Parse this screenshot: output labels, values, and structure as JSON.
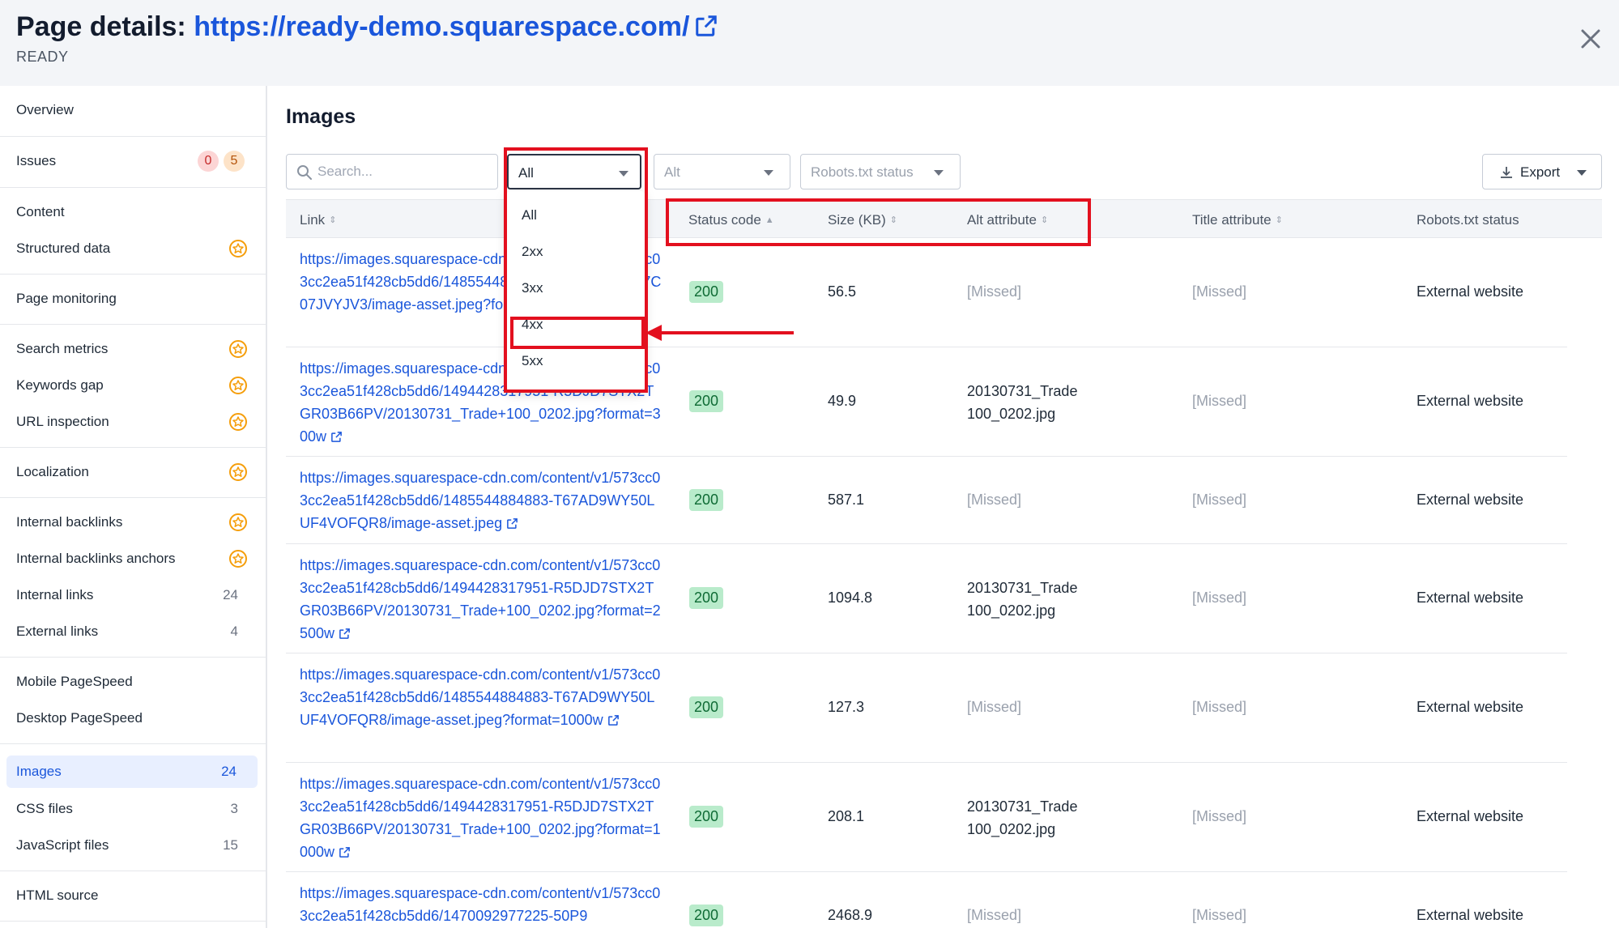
{
  "header": {
    "title_prefix": "Page details: ",
    "url": "https://ready-demo.squarespace.com/",
    "status": "READY"
  },
  "sidebar": {
    "items": [
      {
        "label": "Overview"
      },
      {
        "label": "Issues",
        "badge_errors": "0",
        "badge_warnings": "5"
      },
      {
        "label": "Content"
      },
      {
        "label": "Structured data"
      },
      {
        "label": "Page monitoring"
      },
      {
        "label": "Search metrics"
      },
      {
        "label": "Keywords gap"
      },
      {
        "label": "URL inspection"
      },
      {
        "label": "Localization"
      },
      {
        "label": "Internal backlinks"
      },
      {
        "label": "Internal backlinks anchors"
      },
      {
        "label": "Internal links",
        "count": "24"
      },
      {
        "label": "External links",
        "count": "4"
      },
      {
        "label": "Mobile PageSpeed"
      },
      {
        "label": "Desktop PageSpeed"
      },
      {
        "label": "Images",
        "count": "24"
      },
      {
        "label": "CSS files",
        "count": "3"
      },
      {
        "label": "JavaScript files",
        "count": "15"
      },
      {
        "label": "HTML source"
      }
    ]
  },
  "main": {
    "title": "Images",
    "search_placeholder": "Search...",
    "filters": {
      "status_value": "All",
      "alt_value": "Alt",
      "robots_value": "Robots.txt status"
    },
    "export_label": "Export",
    "status_options": [
      "All",
      "2xx",
      "3xx",
      "4xx",
      "5xx"
    ],
    "columns": [
      "Link",
      "Status code",
      "Size (KB)",
      "Alt attribute",
      "Title attribute",
      "Robots.txt status"
    ],
    "rows": [
      {
        "link": "https://images.squarespace-cdn.com/content/v1/573cc03cc2ea51f428cb5dd6/1485544884883-50P98KC41C7C07JVYJV3/image-asset.jpeg?format=300w",
        "status": "200",
        "size": "56.5",
        "alt": "[Missed]",
        "title": "[Missed]",
        "robots": "External website"
      },
      {
        "link": "https://images.squarespace-cdn.com/content/v1/573cc03cc2ea51f428cb5dd6/1494428317951-R5DJD7STX2TGR03B66PV/20130731_Trade+100_0202.jpg?format=300w",
        "status": "200",
        "size": "49.9",
        "alt": "20130731_Trade 100_0202.jpg",
        "title": "[Missed]",
        "robots": "External website"
      },
      {
        "link": "https://images.squarespace-cdn.com/content/v1/573cc03cc2ea51f428cb5dd6/1485544884883-T67AD9WY50LUF4VOFQR8/image-asset.jpeg",
        "status": "200",
        "size": "587.1",
        "alt": "[Missed]",
        "title": "[Missed]",
        "robots": "External website"
      },
      {
        "link": "https://images.squarespace-cdn.com/content/v1/573cc03cc2ea51f428cb5dd6/1494428317951-R5DJD7STX2TGR03B66PV/20130731_Trade+100_0202.jpg?format=2500w",
        "status": "200",
        "size": "1094.8",
        "alt": "20130731_Trade 100_0202.jpg",
        "title": "[Missed]",
        "robots": "External website"
      },
      {
        "link": "https://images.squarespace-cdn.com/content/v1/573cc03cc2ea51f428cb5dd6/1485544884883-T67AD9WY50LUF4VOFQR8/image-asset.jpeg?format=1000w",
        "status": "200",
        "size": "127.3",
        "alt": "[Missed]",
        "title": "[Missed]",
        "robots": "External website"
      },
      {
        "link": "https://images.squarespace-cdn.com/content/v1/573cc03cc2ea51f428cb5dd6/1494428317951-R5DJD7STX2TGR03B66PV/20130731_Trade+100_0202.jpg?format=1000w",
        "status": "200",
        "size": "208.1",
        "alt": "20130731_Trade 100_0202.jpg",
        "title": "[Missed]",
        "robots": "External website"
      },
      {
        "link": "https://images.squarespace-cdn.com/content/v1/573cc03cc2ea51f428cb5dd6/1470092977225-50P9",
        "status": "200",
        "size": "2468.9",
        "alt": "[Missed]",
        "title": "[Missed]",
        "robots": "External website"
      }
    ]
  },
  "colors": {
    "accent": "#1a56db",
    "annotation": "#e3101f",
    "status_ok_bg": "#b9ebcb"
  },
  "icons": {
    "external": "external-link-icon",
    "close": "close-icon",
    "search": "search-icon",
    "export": "download-icon",
    "premium": "star-badge-icon"
  }
}
